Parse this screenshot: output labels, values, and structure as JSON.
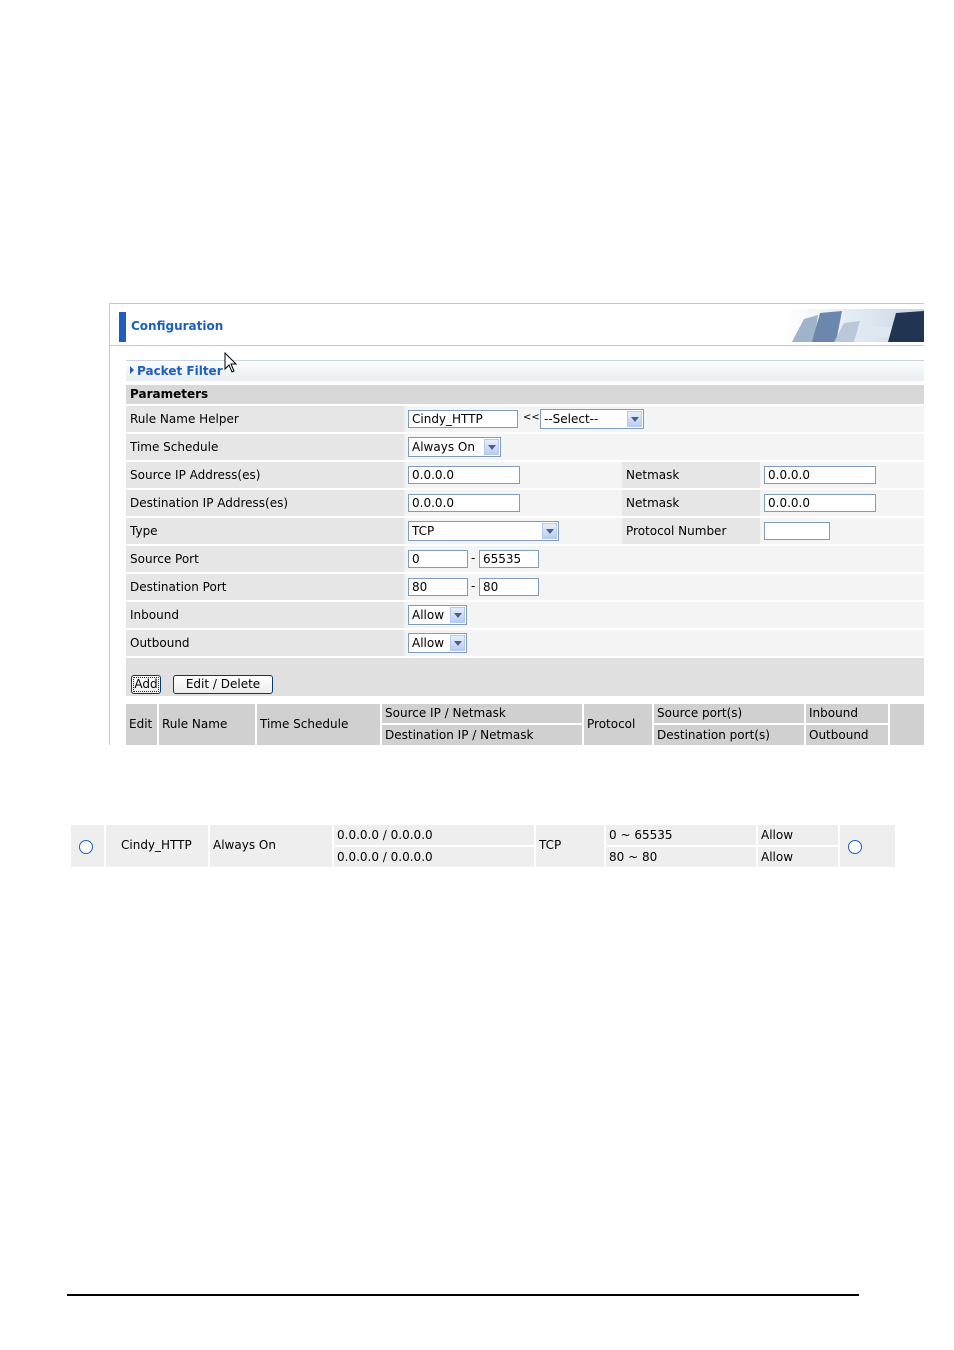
{
  "header": {
    "title": "Configuration"
  },
  "section": {
    "title": "Packet Filter",
    "params_title": "Parameters"
  },
  "form": {
    "rule_name": {
      "label": "Rule Name  Helper",
      "value": "Cindy_HTTP",
      "arrows": "<<",
      "helper_select": "--Select--"
    },
    "time_schedule": {
      "label": "Time Schedule",
      "value": "Always On"
    },
    "source_ip": {
      "label": "Source IP Address(es)",
      "value": "0.0.0.0",
      "netmask_label": "Netmask",
      "netmask": "0.0.0.0"
    },
    "dest_ip": {
      "label": "Destination IP Address(es)",
      "value": "0.0.0.0",
      "netmask_label": "Netmask",
      "netmask": "0.0.0.0"
    },
    "type": {
      "label": "Type",
      "value": "TCP",
      "protocol_label": "Protocol Number",
      "protocol_value": ""
    },
    "source_port": {
      "label": "Source Port",
      "from": "0",
      "to": "65535",
      "sep": "-"
    },
    "dest_port": {
      "label": "Destination Port",
      "from": "80",
      "to": "80",
      "sep": "-"
    },
    "inbound": {
      "label": "Inbound",
      "value": "Allow"
    },
    "outbound": {
      "label": "Outbound",
      "value": "Allow"
    }
  },
  "buttons": {
    "add": "Add",
    "edit_delete": "Edit / Delete"
  },
  "table_headers": {
    "edit": "Edit",
    "rule_name": "Rule Name",
    "time_schedule": "Time Schedule",
    "src_ip": "Source IP / Netmask",
    "dst_ip": "Destination IP / Netmask",
    "protocol": "Protocol",
    "src_port": "Source port(s)",
    "dst_port": "Destination port(s)",
    "inbound": "Inbound",
    "outbound": "Outbound"
  },
  "rule": {
    "name": "Cindy_HTTP",
    "schedule": "Always On",
    "src_ip": "0.0.0.0 / 0.0.0.0",
    "dst_ip": "0.0.0.0 / 0.0.0.0",
    "protocol": "TCP",
    "src_port": "0 ~ 65535",
    "dst_port": "80 ~ 80",
    "inbound": "Allow",
    "outbound": "Allow"
  },
  "colors": {
    "accent": "#1c5fbf",
    "row_bg": "#efefef",
    "header_bg": "#d0d0d0"
  }
}
